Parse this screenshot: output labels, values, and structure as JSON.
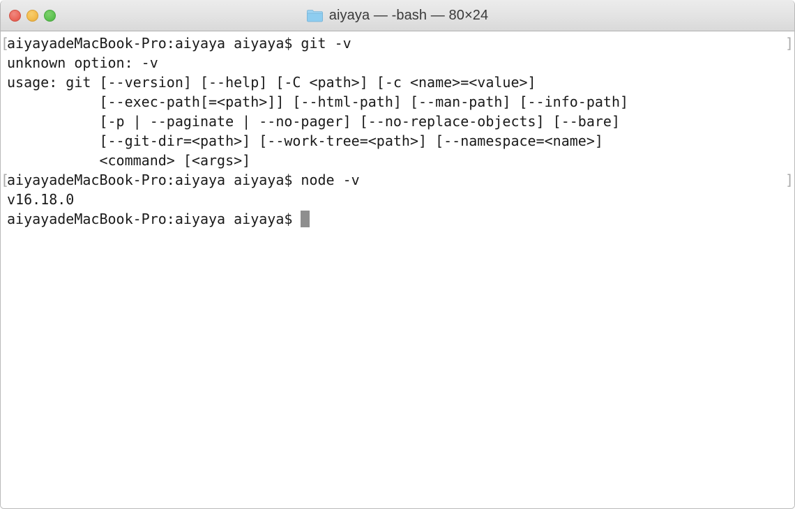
{
  "window": {
    "title": "aiyaya — -bash — 80×24",
    "folder_icon": "folder-icon",
    "accent_blue": "#8ecdf0",
    "titlebar_bg": "#e4e4e4",
    "controls": [
      {
        "name": "close",
        "label": "Close",
        "color": "#ec6a5e"
      },
      {
        "name": "minimize",
        "label": "Minimize",
        "color": "#f4bd4f"
      },
      {
        "name": "maximize",
        "label": "Maximize",
        "color": "#61c454"
      }
    ]
  },
  "terminal": {
    "cols": 80,
    "rows": 24,
    "shell": "-bash",
    "directory": "aiyaya",
    "prompt": "aiyayadeMacBook-Pro:aiyaya aiyaya$ ",
    "wrap_marker_left": "[",
    "wrap_marker_right": "]",
    "wrap_marker_color": "#ababab",
    "foreground": "#1a1a1a",
    "background": "#ffffff",
    "cursor_color": "#8e8e8e",
    "lines": [
      {
        "text": "aiyayadeMacBook-Pro:aiyaya aiyaya$ git -v",
        "wrapped": true
      },
      {
        "text": "unknown option: -v",
        "wrapped": false
      },
      {
        "text": "usage: git [--version] [--help] [-C <path>] [-c <name>=<value>]",
        "wrapped": false
      },
      {
        "text": "           [--exec-path[=<path>]] [--html-path] [--man-path] [--info-path]",
        "wrapped": false
      },
      {
        "text": "           [-p | --paginate | --no-pager] [--no-replace-objects] [--bare]",
        "wrapped": false
      },
      {
        "text": "           [--git-dir=<path>] [--work-tree=<path>] [--namespace=<name>]",
        "wrapped": false
      },
      {
        "text": "           <command> [<args>]",
        "wrapped": false
      },
      {
        "text": "aiyayadeMacBook-Pro:aiyaya aiyaya$ node -v",
        "wrapped": true
      },
      {
        "text": "v16.18.0",
        "wrapped": false
      }
    ],
    "current_prompt": "aiyayadeMacBook-Pro:aiyaya aiyaya$ ",
    "input_value": ""
  }
}
